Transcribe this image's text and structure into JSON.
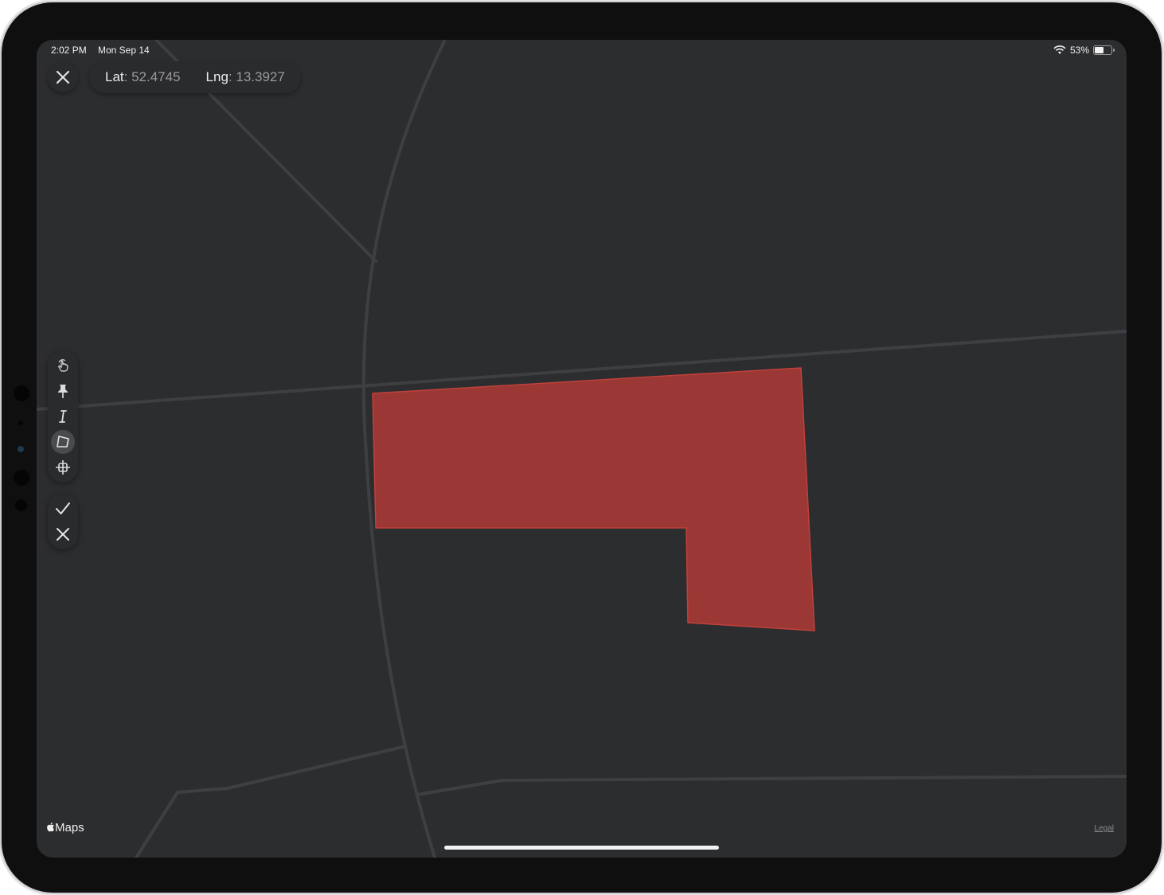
{
  "status_bar": {
    "time": "2:02 PM",
    "date": "Mon Sep 14",
    "battery": "53%",
    "battery_level": 0.53
  },
  "coordinates": {
    "lat_label": "Lat",
    "lat_value": "52.4745",
    "lng_label": "Lng",
    "lng_value": "13.3927"
  },
  "toolbar": {
    "tools": [
      {
        "name": "pan",
        "icon": "hand-tap-icon",
        "active": false
      },
      {
        "name": "pin",
        "icon": "pin-icon",
        "active": false
      },
      {
        "name": "text",
        "icon": "text-cursor-icon",
        "active": false
      },
      {
        "name": "polygon",
        "icon": "polygon-icon",
        "active": true
      },
      {
        "name": "grid",
        "icon": "grid-crosshair-icon",
        "active": false
      }
    ],
    "actions": [
      {
        "name": "confirm",
        "icon": "checkmark-icon"
      },
      {
        "name": "cancel",
        "icon": "close-icon"
      }
    ]
  },
  "map": {
    "brand": "Maps",
    "legal": "Legal",
    "background_color": "#2c2d2f",
    "road_color": "#3e3f42",
    "polygon_fill": "#9b3734",
    "polygon_stroke": "#c0413c"
  }
}
